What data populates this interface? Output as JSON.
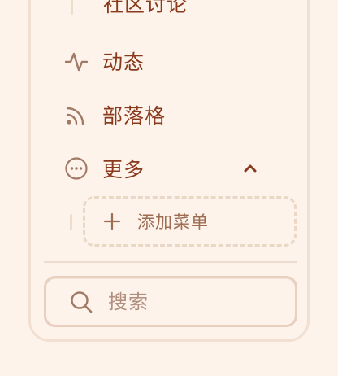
{
  "nav": {
    "partial_item": {
      "label": "社区讨论"
    },
    "items": [
      {
        "id": "activity",
        "label": "动态",
        "icon": "activity-icon"
      },
      {
        "id": "blog",
        "label": "部落格",
        "icon": "rss-icon"
      },
      {
        "id": "more",
        "label": "更多",
        "icon": "more-icon",
        "expanded": true
      }
    ],
    "more_submenu": {
      "add_label": "添加菜单",
      "add_icon": "plus-icon"
    }
  },
  "search": {
    "placeholder": "搜索",
    "value": "",
    "icon": "search-icon"
  },
  "colors": {
    "background": "#fdf3ea",
    "text": "#8a3a1c",
    "muted": "#9e6c52",
    "border": "#f1dfd1"
  }
}
